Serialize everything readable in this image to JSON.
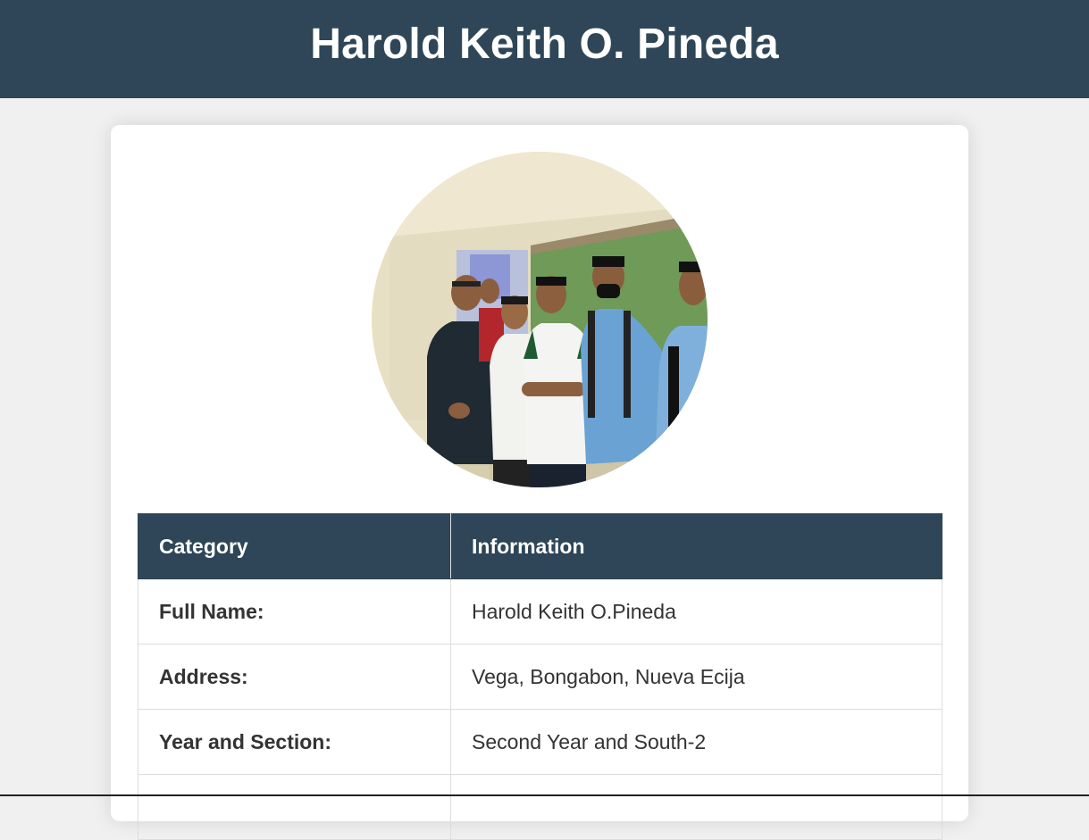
{
  "header": {
    "title": "Harold Keith O. Pineda"
  },
  "profile": {
    "photo_icon": "group-photo-image"
  },
  "table": {
    "headers": [
      "Category",
      "Information"
    ],
    "rows": [
      {
        "category": "Full Name:",
        "information": "Harold Keith O.Pineda"
      },
      {
        "category": "Address:",
        "information": "Vega, Bongabon, Nueva Ecija"
      },
      {
        "category": "Year and Section:",
        "information": "Second Year and South-2"
      },
      {
        "category": "",
        "information": ""
      }
    ]
  },
  "colors": {
    "header_bg": "#2e4657",
    "page_bg": "#f0f0f0",
    "card_bg": "#ffffff",
    "text": "#333333"
  }
}
